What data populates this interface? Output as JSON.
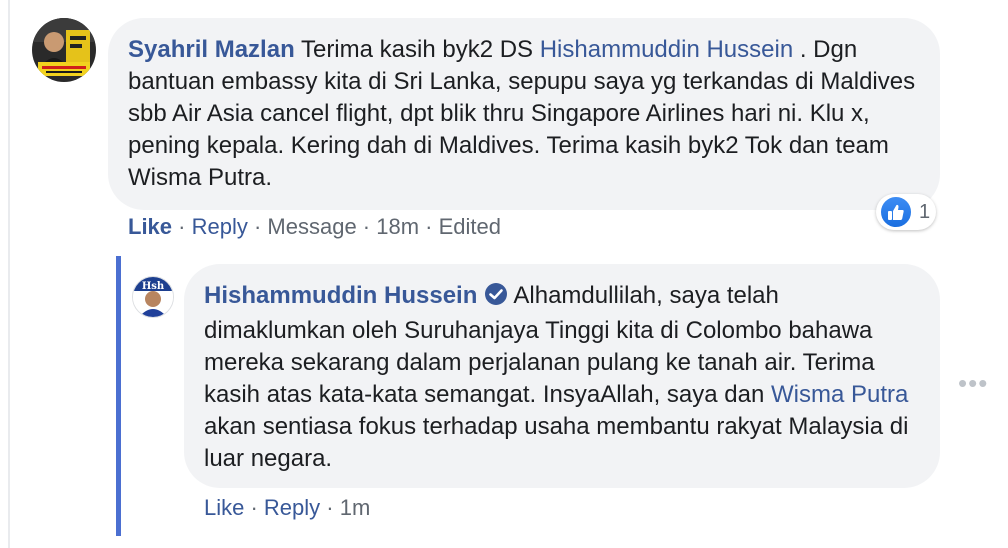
{
  "comment": {
    "author": "Syahril Mazlan",
    "text_line1_pre": " Terima kasih byk2 DS ",
    "text_line1_mention": "Hishammuddin Hussein",
    "text_line1_post": " . Dgn",
    "text_rest": "bantuan embassy kita di Sri Lanka, sepupu saya yg terkandas di Maldives sbb Air Asia cancel flight, dpt blik thru Singapore Airlines hari ni. Klu x, pening kepala. Kering dah di Maldives. Terima kasih byk2 Tok dan team Wisma Putra.",
    "actions": {
      "like": "Like",
      "reply": "Reply",
      "message": "Message",
      "time": "18m",
      "edited": "Edited",
      "sep": " · "
    },
    "reaction": {
      "icon": "like-icon",
      "count": "1"
    }
  },
  "reply": {
    "author": "Hishammuddin Hussein",
    "verified_icon": "verified-badge-icon",
    "text_pre": " Alhamdullilah, saya telah dimaklumkan oleh Suruhanjaya Tinggi kita di Colombo bahawa mereka sekarang dalam perjalanan pulang ke tanah air. Terima kasih atas kata-kata semangat. InsyaAllah, saya dan ",
    "text_mention": "Wisma Putra",
    "text_post": " akan sentiasa fokus terhadap usaha membantu rakyat Malaysia di luar negara.",
    "actions": {
      "like": "Like",
      "reply": "Reply",
      "time": "1m",
      "sep": " · "
    }
  },
  "more_options": "•••",
  "colors": {
    "link": "#385898",
    "bubble": "#f2f3f5",
    "thread_rule": "#4b6fd1",
    "meta": "#606770"
  }
}
